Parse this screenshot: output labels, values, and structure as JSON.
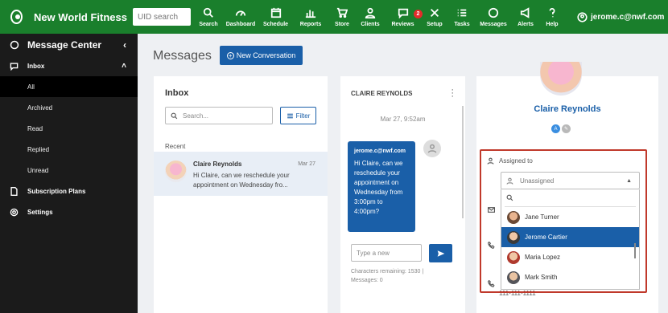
{
  "app": {
    "name": "New World Fitness",
    "uid_placeholder": "UID search",
    "user": "jerome.c@nwf.com"
  },
  "nav": [
    {
      "label": "Search",
      "icon": "search-icon"
    },
    {
      "label": "Dashboard",
      "icon": "dashboard-icon"
    },
    {
      "label": "Schedule",
      "icon": "calendar-icon"
    },
    {
      "label": "Reports",
      "icon": "bar-chart-icon"
    },
    {
      "label": "Store",
      "icon": "cart-icon"
    },
    {
      "label": "Clients",
      "icon": "person-icon"
    },
    {
      "label": "Reviews",
      "icon": "chat-icon",
      "badge": "2"
    },
    {
      "label": "Setup",
      "icon": "tools-icon"
    },
    {
      "label": "Tasks",
      "icon": "checklist-icon"
    },
    {
      "label": "Messages",
      "icon": "message-icon"
    },
    {
      "label": "Alerts",
      "icon": "megaphone-icon"
    },
    {
      "label": "Help",
      "icon": "question-icon"
    }
  ],
  "sidebar": {
    "title": "Message Center",
    "inbox_label": "Inbox",
    "inbox_items": [
      "All",
      "Archived",
      "Read",
      "Replied",
      "Unread"
    ],
    "subscription_label": "Subscription Plans",
    "settings_label": "Settings"
  },
  "main": {
    "title": "Messages",
    "new_conversation": "New Conversation"
  },
  "inbox": {
    "title": "Inbox",
    "search_placeholder": "Search...",
    "filter_label": "Filter",
    "recent_label": "Recent",
    "conversation": {
      "name": "Claire Reynolds",
      "date": "Mar 27",
      "preview": "Hi Claire, can we reschedule your appointment on Wednesday fro..."
    }
  },
  "chat": {
    "contact_name": "CLAIRE REYNOLDS",
    "timestamp": "Mar 27, 9:52am",
    "message_from": "jerome.c@nwf.com",
    "message_text": "Hi Claire, can we reschedule your appointment on Wednesday from 3:00pm to 4:00pm?",
    "input_placeholder": "Type a new",
    "chars_remaining": "Characters remaining: 1530 |",
    "messages_count": "Messages: 0"
  },
  "contact": {
    "name": "Claire Reynolds",
    "tags": [
      "A",
      "✎"
    ],
    "assigned_to_label": "Assigned to",
    "assigned_value": "Unassigned",
    "options": [
      "Jane Turner",
      "Jerome Cartier",
      "Maria Lopez",
      "Mark Smith"
    ],
    "selected_option": "Jerome Cartier",
    "phone": "111-111-1111"
  },
  "colors": {
    "brand_green": "#1a7f2c",
    "primary_blue": "#1a5fa8",
    "highlight_red": "#c0392b",
    "sidebar_bg": "#1b1b1b"
  }
}
